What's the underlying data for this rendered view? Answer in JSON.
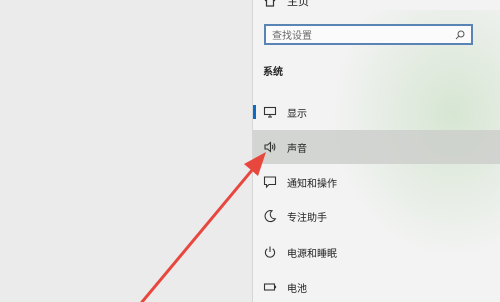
{
  "nav": {
    "home_label": "主页",
    "search_placeholder": "查找设置",
    "section_title": "系统",
    "items": [
      {
        "label": "显示",
        "icon": "monitor-icon"
      },
      {
        "label": "声音",
        "icon": "speaker-icon"
      },
      {
        "label": "通知和操作",
        "icon": "notification-icon"
      },
      {
        "label": "专注助手",
        "icon": "moon-icon"
      },
      {
        "label": "电源和睡眠",
        "icon": "power-icon"
      },
      {
        "label": "电池",
        "icon": "battery-icon"
      }
    ]
  },
  "colors": {
    "accent": "#0b6cc4",
    "search_border": "#5a84b6",
    "annotation_arrow": "#e8473e",
    "hover_row": "#cfd1cd"
  }
}
